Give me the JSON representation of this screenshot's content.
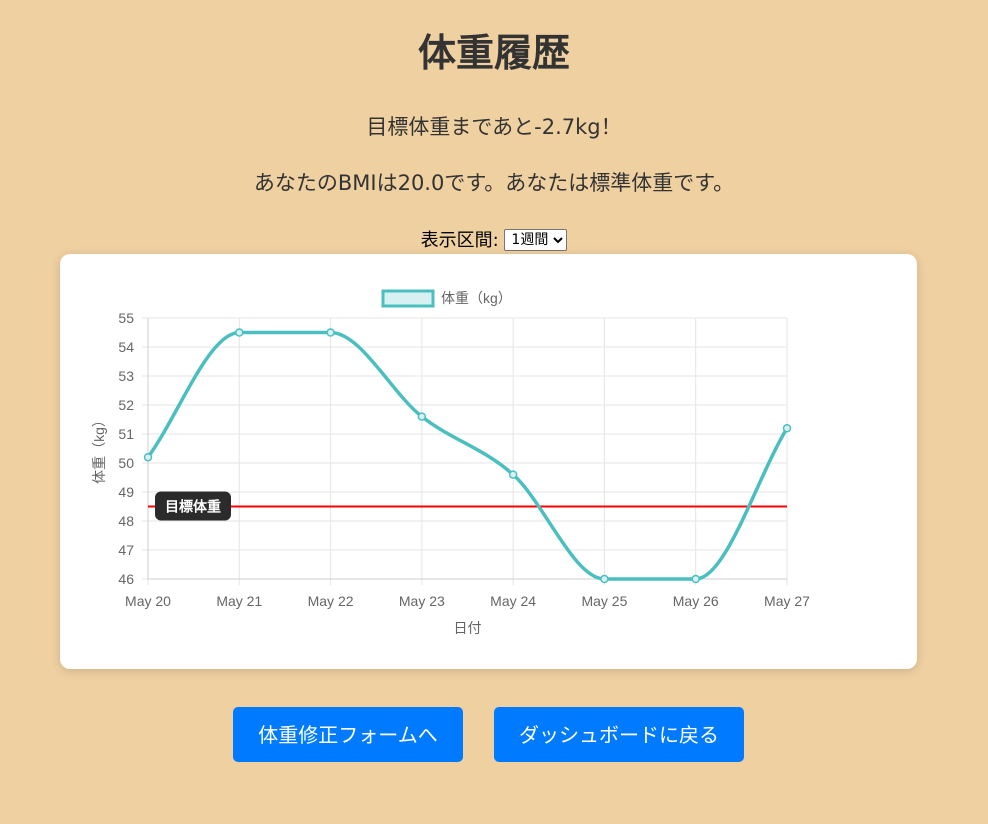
{
  "page": {
    "title": "体重履歴",
    "goal_message": "目標体重まであと-2.7kg！",
    "bmi_message": "あなたのBMIは20.0です。あなたは標準体重です。"
  },
  "range_selector": {
    "label": "表示区間:",
    "selected": "1週間"
  },
  "chart_data": {
    "type": "line",
    "legend": "体重（kg）",
    "legend_position": "top",
    "xlabel": "日付",
    "ylabel": "体重（kg）",
    "categories": [
      "May 20",
      "May 21",
      "May 22",
      "May 23",
      "May 24",
      "May 25",
      "May 26",
      "May 27"
    ],
    "series": [
      {
        "name": "体重（kg）",
        "values": [
          50.2,
          54.5,
          54.5,
          51.6,
          49.6,
          46.0,
          46.0,
          51.2
        ],
        "color": "#4bbfc0",
        "fill": "#d7f0f1"
      }
    ],
    "ylim": [
      46,
      55
    ],
    "yticks": [
      "46",
      "47",
      "48",
      "49",
      "50",
      "51",
      "52",
      "53",
      "54",
      "55"
    ],
    "grid": true,
    "goal_line": {
      "value": 48.5,
      "label": "目標体重",
      "color": "#ff0000"
    }
  },
  "buttons": {
    "edit_label": "体重修正フォームへ",
    "back_label": "ダッシュボードに戻る",
    "color": "#007bff"
  }
}
